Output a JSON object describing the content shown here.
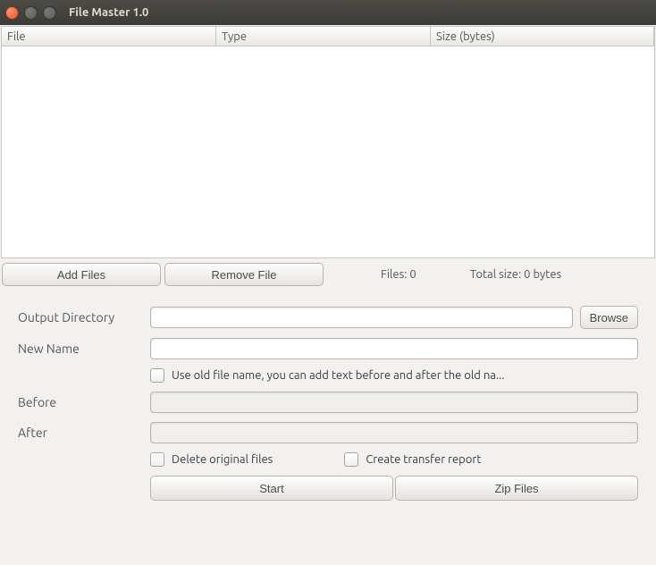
{
  "window": {
    "title": "File Master 1.0"
  },
  "table": {
    "columns": [
      "File",
      "Type",
      "Size (bytes)"
    ],
    "rows": []
  },
  "actions": {
    "add_files": "Add Files",
    "remove_file": "Remove File"
  },
  "stats": {
    "files_label": "Files:",
    "files_count": "0",
    "total_label": "Total size:",
    "total_value": "0 bytes"
  },
  "form": {
    "output_dir_label": "Output Directory",
    "output_dir_value": "",
    "browse_label": "Browse",
    "new_name_label": "New Name",
    "new_name_value": "",
    "use_old_label": "Use old file name, you can add text before and after the old na...",
    "before_label": "Before",
    "before_value": "",
    "after_label": "After",
    "after_value": "",
    "delete_original_label": "Delete original files",
    "transfer_report_label": "Create transfer report",
    "start_label": "Start",
    "zip_label": "Zip Files"
  }
}
